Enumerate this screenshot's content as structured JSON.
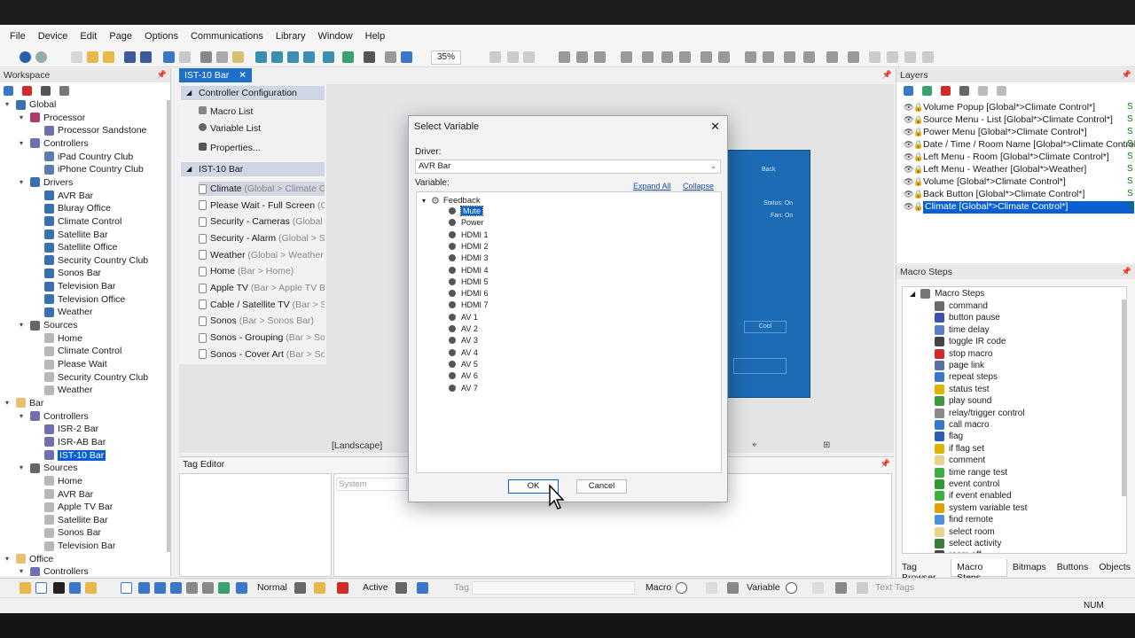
{
  "menu": [
    "File",
    "Device",
    "Edit",
    "Page",
    "Options",
    "Communications",
    "Library",
    "Window",
    "Help"
  ],
  "toolbar": {
    "zoom": "35%"
  },
  "workspace": {
    "title": "Workspace",
    "tree": [
      {
        "label": "Global",
        "level": 0,
        "icon": "globe-icon"
      },
      {
        "label": "Processor",
        "level": 1,
        "icon": "processor-icon"
      },
      {
        "label": "Processor Sandstone",
        "level": 2,
        "icon": "device-icon"
      },
      {
        "label": "Controllers",
        "level": 1,
        "icon": "controllers-icon"
      },
      {
        "label": "iPad Country Club",
        "level": 2,
        "icon": "tablet-icon"
      },
      {
        "label": "iPhone Country Club",
        "level": 2,
        "icon": "phone-icon"
      },
      {
        "label": "Drivers",
        "level": 1,
        "icon": "gear-icon"
      },
      {
        "label": "AVR Bar",
        "level": 2,
        "icon": "gear-icon"
      },
      {
        "label": "Bluray Office",
        "level": 2,
        "icon": "gear-icon"
      },
      {
        "label": "Climate Control",
        "level": 2,
        "icon": "gear-icon"
      },
      {
        "label": "Satellite Bar",
        "level": 2,
        "icon": "gear-icon"
      },
      {
        "label": "Satellite Office",
        "level": 2,
        "icon": "gear-icon"
      },
      {
        "label": "Security Country Club",
        "level": 2,
        "icon": "gear-icon"
      },
      {
        "label": "Sonos Bar",
        "level": 2,
        "icon": "gear-icon"
      },
      {
        "label": "Television Bar",
        "level": 2,
        "icon": "gear-icon"
      },
      {
        "label": "Television Office",
        "level": 2,
        "icon": "gear-icon"
      },
      {
        "label": "Weather",
        "level": 2,
        "icon": "gear-icon"
      },
      {
        "label": "Sources",
        "level": 1,
        "icon": "sources-icon"
      },
      {
        "label": "Home",
        "level": 2,
        "icon": "source-icon"
      },
      {
        "label": "Climate Control",
        "level": 2,
        "icon": "source-icon"
      },
      {
        "label": "Please Wait",
        "level": 2,
        "icon": "source-icon"
      },
      {
        "label": "Security Country Club",
        "level": 2,
        "icon": "source-icon"
      },
      {
        "label": "Weather",
        "level": 2,
        "icon": "source-icon"
      },
      {
        "label": "Bar",
        "level": 0,
        "icon": "room-icon"
      },
      {
        "label": "Controllers",
        "level": 1,
        "icon": "controllers-icon"
      },
      {
        "label": "ISR-2 Bar",
        "level": 2,
        "icon": "device-icon"
      },
      {
        "label": "ISR-AB Bar",
        "level": 2,
        "icon": "device-icon"
      },
      {
        "label": "IST-10 Bar",
        "level": 2,
        "icon": "device-icon",
        "selected": true
      },
      {
        "label": "Sources",
        "level": 1,
        "icon": "sources-icon"
      },
      {
        "label": "Home",
        "level": 2,
        "icon": "source-icon"
      },
      {
        "label": "AVR Bar",
        "level": 2,
        "icon": "source-icon"
      },
      {
        "label": "Apple TV Bar",
        "level": 2,
        "icon": "source-icon"
      },
      {
        "label": "Satellite Bar",
        "level": 2,
        "icon": "source-icon"
      },
      {
        "label": "Sonos Bar",
        "level": 2,
        "icon": "source-icon"
      },
      {
        "label": "Television Bar",
        "level": 2,
        "icon": "source-icon"
      },
      {
        "label": "Office",
        "level": 0,
        "icon": "room-icon"
      },
      {
        "label": "Controllers",
        "level": 1,
        "icon": "controllers-icon"
      }
    ]
  },
  "editor": {
    "tab": "IST-10 Bar",
    "config_header": "Controller Configuration",
    "config_items": [
      "Macro List",
      "Variable List",
      "Properties..."
    ],
    "controller_header": "IST-10 Bar",
    "pages": [
      {
        "name": "Climate",
        "path": "(Global > Climate C"
      },
      {
        "name": "Please Wait - Full Screen",
        "path": "(Global"
      },
      {
        "name": "Security - Cameras",
        "path": "(Global"
      },
      {
        "name": "Security - Alarm",
        "path": "(Global > S"
      },
      {
        "name": "Weather",
        "path": "(Global > Weather"
      },
      {
        "name": "Home",
        "path": "(Bar > Home)"
      },
      {
        "name": "Apple TV",
        "path": "(Bar > Apple TV B"
      },
      {
        "name": "Cable / Satellite TV",
        "path": "(Bar > S"
      },
      {
        "name": "Sonos",
        "path": "(Bar > Sonos Bar)"
      },
      {
        "name": "Sonos - Grouping",
        "path": "(Bar > So"
      },
      {
        "name": "Sonos - Cover Art",
        "path": "(Bar > So"
      }
    ],
    "canvas": {
      "back": "Back",
      "status": "Status: On",
      "fan": "Fan: On",
      "cool": "Cool"
    },
    "orientation": "[Landscape]"
  },
  "tag_editor": {
    "title": "Tag Editor",
    "system": "System"
  },
  "layers": {
    "title": "Layers",
    "items": [
      "Volume Popup [Global*>Climate Control*]",
      "Source Menu - List [Global*>Climate Control*]",
      "Power Menu [Global*>Climate Control*]",
      "Date / Time / Room Name [Global*>Climate Control*]",
      "Left Menu - Room [Global*>Climate Control*]",
      "Left Menu - Weather [Global*>Weather]",
      "Volume [Global*>Climate Control*]",
      "Back Button [Global*>Climate Control*]",
      "Climate [Global*>Climate Control*]"
    ],
    "flag": "S"
  },
  "macro_steps": {
    "title": "Macro Steps",
    "root": "Macro Steps",
    "items": [
      {
        "label": "command",
        "color": "#6b6b6b"
      },
      {
        "label": "button pause",
        "color": "#3b4fb3"
      },
      {
        "label": "time delay",
        "color": "#5b7fc9"
      },
      {
        "label": "toggle IR code",
        "color": "#444444"
      },
      {
        "label": "stop macro",
        "color": "#d22a2a"
      },
      {
        "label": "page link",
        "color": "#5a6fa8"
      },
      {
        "label": "repeat steps",
        "color": "#3a77c9"
      },
      {
        "label": "status test",
        "color": "#e0b300"
      },
      {
        "label": "play sound",
        "color": "#3a9a3a"
      },
      {
        "label": "relay/trigger control",
        "color": "#8a8a8a"
      },
      {
        "label": "call macro",
        "color": "#3a77c9"
      },
      {
        "label": "flag",
        "color": "#2a5fb0"
      },
      {
        "label": "if flag set",
        "color": "#e0b300"
      },
      {
        "label": "comment",
        "color": "#e8d48a"
      },
      {
        "label": "time range test",
        "color": "#3fae3f"
      },
      {
        "label": "event control",
        "color": "#2f9a2f"
      },
      {
        "label": "if event enabled",
        "color": "#3fae3f"
      },
      {
        "label": "system variable test",
        "color": "#e0a000"
      },
      {
        "label": "find remote",
        "color": "#4a90d9"
      },
      {
        "label": "select room",
        "color": "#e8d48a"
      },
      {
        "label": "select activity",
        "color": "#3a7a3a"
      },
      {
        "label": "room off",
        "color": "#444444"
      }
    ],
    "tabs": [
      "Tag Browser",
      "Macro Steps",
      "Bitmaps",
      "Buttons",
      "Objects"
    ]
  },
  "bottom_toolbar": {
    "normal": "Normal",
    "active": "Active",
    "tag": "Tag",
    "macro": "Macro",
    "variable": "Variable",
    "text_tags": "Text Tags"
  },
  "status": {
    "num": "NUM"
  },
  "dialog": {
    "title": "Select Variable",
    "driver_label": "Driver:",
    "driver_value": "AVR Bar",
    "variable_label": "Variable:",
    "expand_all": "Expand All",
    "collapse": "Collapse",
    "root": "Feedback",
    "variables": [
      "Mute",
      "Power",
      "HDMI 1",
      "HDMI 2",
      "HDMI 3",
      "HDMI 4",
      "HDMI 5",
      "HDMI 6",
      "HDMI 7",
      "AV 1",
      "AV 2",
      "AV 3",
      "AV 4",
      "AV 5",
      "AV 6",
      "AV 7"
    ],
    "selected": "Mute",
    "ok": "OK",
    "cancel": "Cancel"
  }
}
